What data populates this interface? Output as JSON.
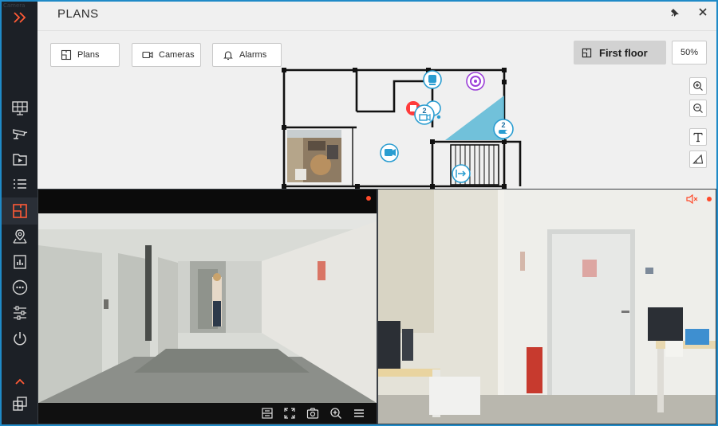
{
  "rail": {
    "corner_text": "Camera",
    "items": [
      {
        "icon": "monitor-grid-icon"
      },
      {
        "icon": "camera-icon"
      },
      {
        "icon": "play-archive-icon"
      },
      {
        "icon": "event-list-icon"
      },
      {
        "icon": "plans-icon",
        "active": true
      },
      {
        "icon": "map-pin-icon"
      },
      {
        "icon": "reports-icon"
      },
      {
        "icon": "more-icon"
      },
      {
        "icon": "settings-sliders-icon"
      },
      {
        "icon": "power-icon"
      },
      {
        "icon": "expand-up-icon"
      },
      {
        "icon": "layouts-icon"
      }
    ]
  },
  "plans": {
    "title": "PLANS",
    "tabs": [
      {
        "label": "Plans",
        "icon": "plan-icon"
      },
      {
        "label": "Cameras",
        "icon": "camera-outline-icon"
      },
      {
        "label": "Alarms",
        "icon": "bell-icon"
      }
    ],
    "floor": "First floor",
    "zoom": "50%",
    "markers": [
      {
        "type": "camera",
        "count": "2"
      },
      {
        "type": "camera",
        "count": "2"
      }
    ]
  },
  "colors": {
    "accent": "#ff5a36",
    "marker": "#2a9dd1",
    "dome": "#9b3fd8",
    "frame_border": "#1f8ac7",
    "fov": "#5ab8d6"
  }
}
